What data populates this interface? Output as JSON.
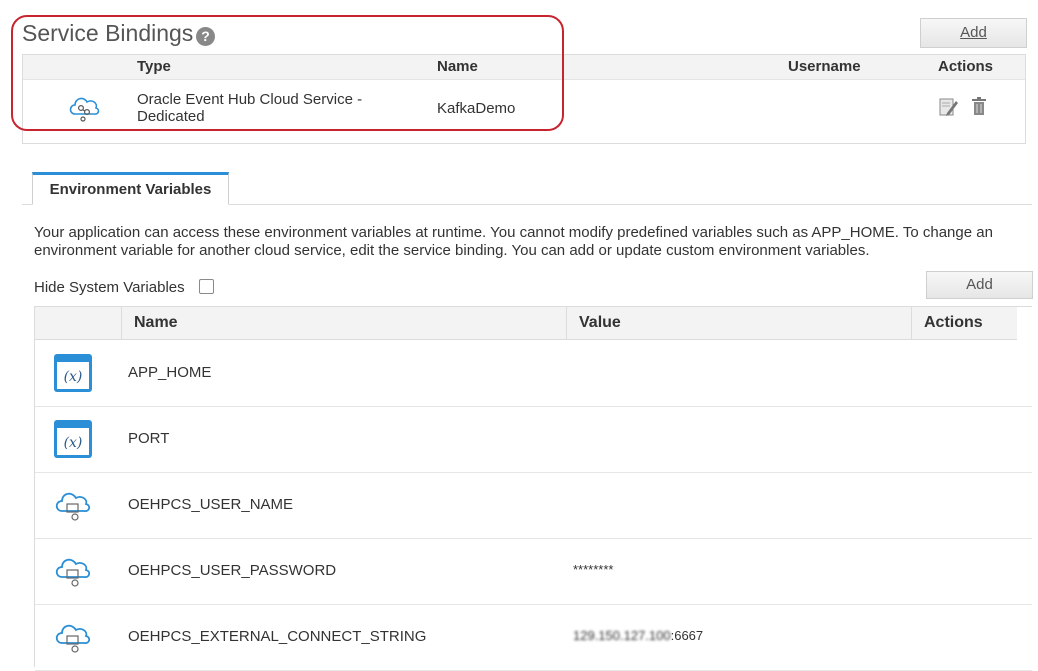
{
  "service_bindings": {
    "title": "Service Bindings",
    "help_icon": "?",
    "add_label": "Add",
    "columns": {
      "type": "Type",
      "name": "Name",
      "username": "Username",
      "actions": "Actions"
    },
    "rows": [
      {
        "icon": "cloud-event-hub-icon",
        "type_line1": "Oracle Event Hub Cloud Service -",
        "type_line2": "Dedicated",
        "name": "KafkaDemo",
        "username": ""
      }
    ]
  },
  "tabs": [
    {
      "label": "Environment Variables",
      "active": true
    }
  ],
  "environment": {
    "description": "Your application can access these environment variables at runtime. You cannot modify predefined variables such as APP_HOME. To change an environment variable for another cloud service, edit the service binding. You can add or update custom environment variables.",
    "hide_system_label": "Hide System Variables",
    "hide_system_checked": false,
    "add_label": "Add",
    "columns": {
      "name": "Name",
      "value": "Value",
      "actions": "Actions"
    },
    "rows": [
      {
        "icon": "variable-icon",
        "name": "APP_HOME",
        "value": ""
      },
      {
        "icon": "variable-icon",
        "name": "PORT",
        "value": ""
      },
      {
        "icon": "cloud-service-icon",
        "name": "OEHPCS_USER_NAME",
        "value": ""
      },
      {
        "icon": "cloud-service-icon",
        "name": "OEHPCS_USER_PASSWORD",
        "value": "********"
      },
      {
        "icon": "cloud-service-icon",
        "name": "OEHPCS_EXTERNAL_CONNECT_STRING",
        "value_blurred": "129.150.127.100",
        "value_tail": ":6667"
      }
    ]
  },
  "colors": {
    "accent": "#2a8fd6",
    "highlight": "#c8242f",
    "icon_blue": "#2a8fd6"
  }
}
